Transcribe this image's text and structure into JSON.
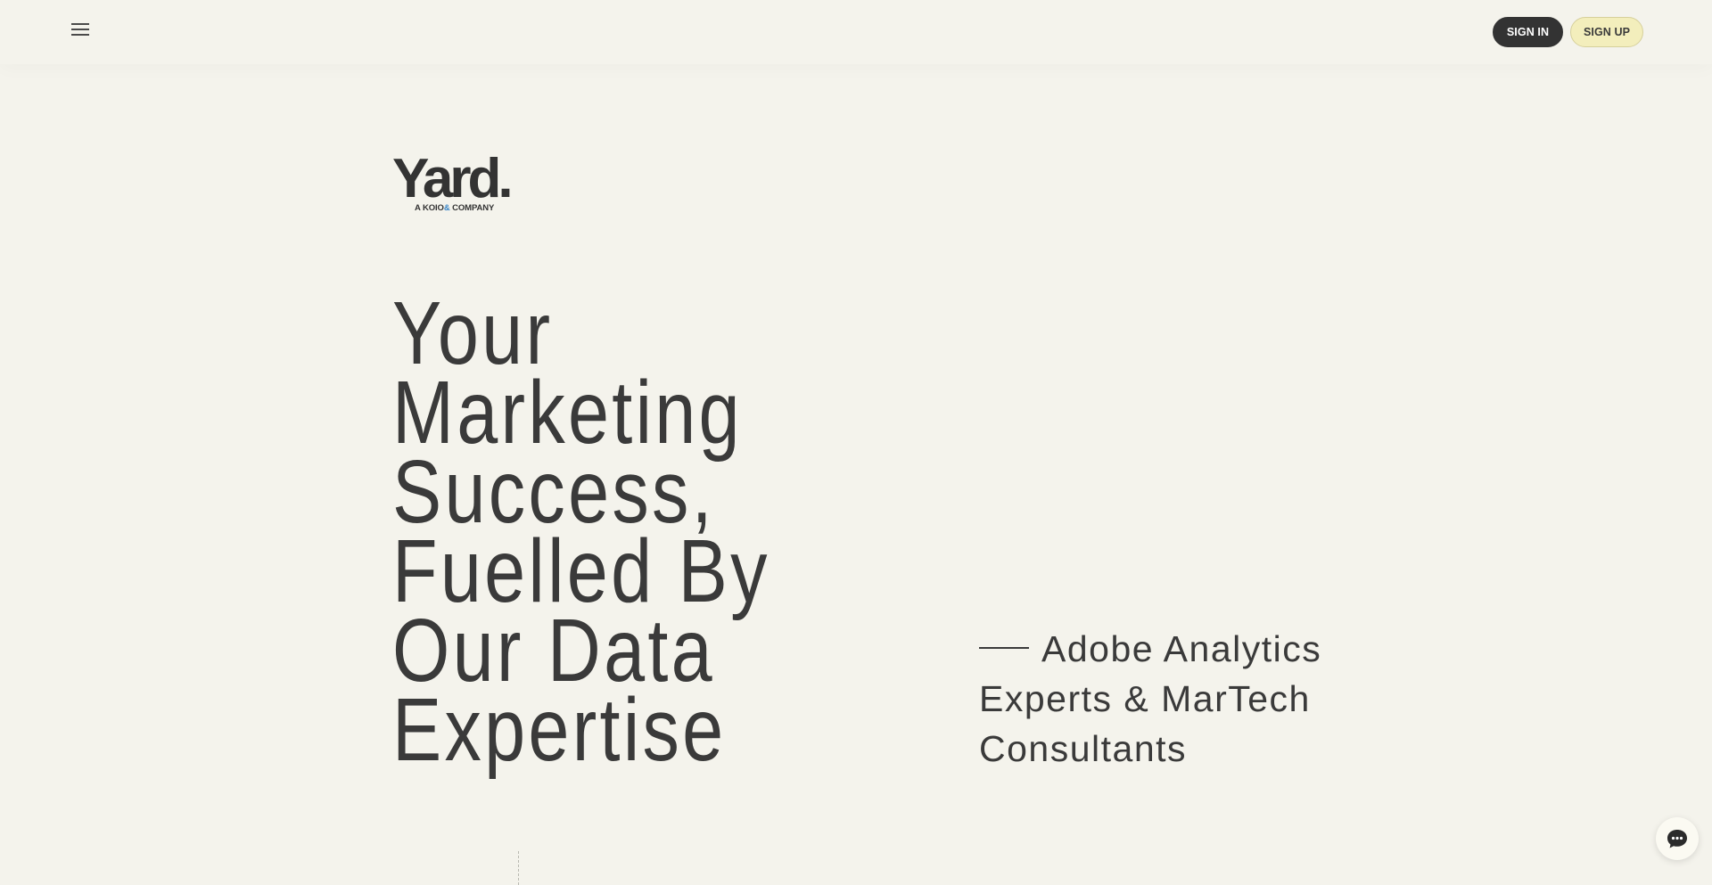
{
  "header": {
    "menu_icon": "hamburger-menu-icon",
    "sign_in_label": "SIGN IN",
    "sign_up_label": "SIGN UP"
  },
  "logo": {
    "wordmark": "Yard.",
    "subtitle_prefix": "A KOIO",
    "subtitle_amp": "&",
    "subtitle_suffix": " COMPANY"
  },
  "hero": {
    "lines": [
      "Your",
      "Marketing",
      "Success,",
      "Fuelled By",
      "Our Data",
      "Expertise"
    ]
  },
  "tagline": {
    "line1": "Adobe Analytics",
    "line2": "Experts & MarTech",
    "line3": "Consultants"
  },
  "chat": {
    "icon": "chat-bubble-icon"
  },
  "colors": {
    "background": "#f4f3ec",
    "text": "#3a3a3a",
    "sign_in_bg": "#333333",
    "sign_up_bg": "#f3eebc",
    "logo_amp": "#3a86c8"
  }
}
